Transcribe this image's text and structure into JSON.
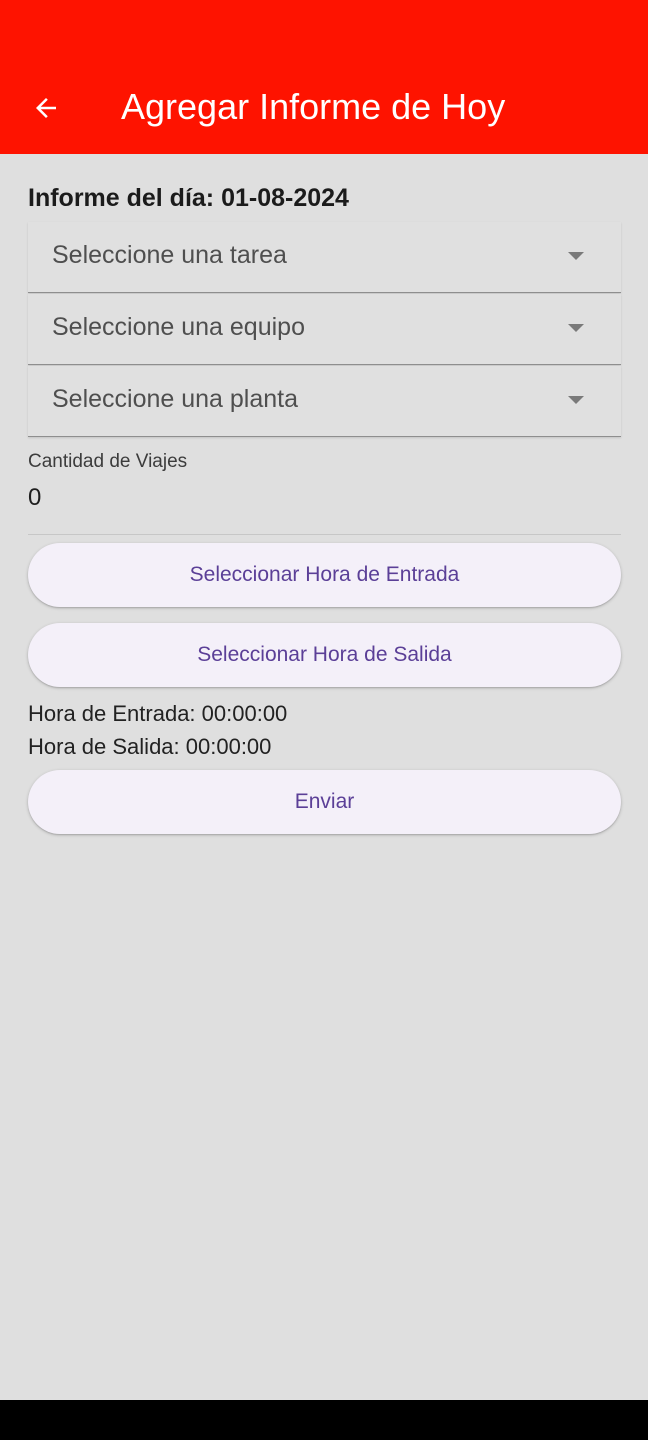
{
  "appbar": {
    "title": "Agregar Informe de Hoy",
    "back_icon": "arrow-left-icon",
    "background_color": "#fe1300"
  },
  "form": {
    "report_date": "Informe del día: 01-08-2024",
    "dropdowns": [
      {
        "placeholder": "Seleccione una tarea",
        "icon": "caret-down-icon"
      },
      {
        "placeholder": "Seleccione una equipo",
        "icon": "caret-down-icon"
      },
      {
        "placeholder": "Seleccione una planta",
        "icon": "caret-down-icon"
      }
    ],
    "trips": {
      "label": "Cantidad de Viajes",
      "value": "0"
    },
    "buttons": {
      "entry_time": "Seleccionar Hora de Entrada",
      "exit_time": "Seleccionar Hora de Salida",
      "submit": "Enviar"
    },
    "times": {
      "entry": "Hora de Entrada: 00:00:00",
      "exit": "Hora de Salida: 00:00:00"
    }
  },
  "colors": {
    "accent": "#fe1300",
    "button_text": "#5b3f97",
    "button_bg": "#f4f0f9",
    "page_bg": "#dfdfdf"
  }
}
